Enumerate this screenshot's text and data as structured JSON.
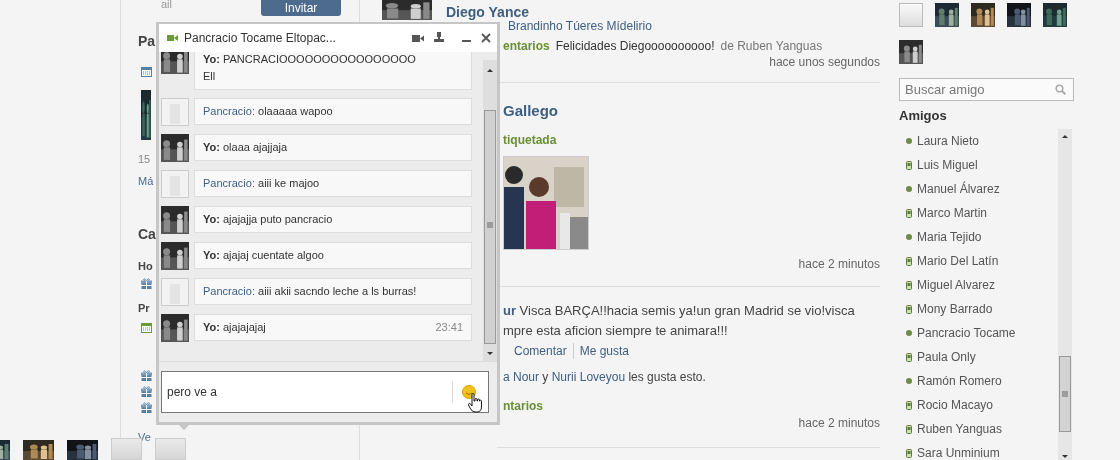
{
  "left_column": {
    "field_fragment": "ail",
    "invite_button": "Invitar",
    "heading": "Pa",
    "count": "15",
    "link": "Má",
    "section_heading": "Ca",
    "label_today": "Ho",
    "label_next": "Pr",
    "link_more": "Ve"
  },
  "feed": {
    "posts": [
      {
        "avatar": {
          "kind": "picture"
        },
        "author": "Diego Yance",
        "tagged": "Brandinho Túeres Mídelirio",
        "comments_label": "entarios",
        "comment": {
          "text": "Felicidades Diegoooooooooo!",
          "by": "de Ruben Yanguas"
        },
        "time": "hace unos segundos"
      },
      {
        "author": "Gallego",
        "activity": "tiquetada",
        "photo": {
          "kind": "picture"
        },
        "time": "hace 2 minutos"
      },
      {
        "author": "ur",
        "status_lines": [
          "Visca BARÇA!!hacia semis ya!un gran Madrid se vio!visca",
          "mpre esta aficion siempre te animara!!!"
        ],
        "actions": [
          "Comentar",
          "Me gusta"
        ],
        "likes": {
          "names": [
            "a Nour",
            "Nurii Loveyou"
          ],
          "joiner": "y",
          "suffix": "les gusta esto."
        },
        "comments_label": "ntarios",
        "time": "hace 2 minutos"
      }
    ]
  },
  "right_column": {
    "photos": [
      {
        "kind": "blank"
      },
      {
        "kind": "picture"
      },
      {
        "kind": "picture"
      },
      {
        "kind": "picture"
      },
      {
        "kind": "picture"
      },
      {
        "kind": "picture"
      }
    ],
    "search": {
      "placeholder": "Buscar amigo"
    },
    "friends_heading": "Amigos",
    "friends": [
      {
        "name": "Laura Nieto",
        "kind": "online"
      },
      {
        "name": "Luis Miguel",
        "kind": "mobile"
      },
      {
        "name": "Manuel Álvarez",
        "kind": "online"
      },
      {
        "name": "Marco Martin",
        "kind": "mobile"
      },
      {
        "name": "Maria Tejido",
        "kind": "online"
      },
      {
        "name": "Mario Del Latín",
        "kind": "mobile"
      },
      {
        "name": "Miguel Alvarez",
        "kind": "mobile"
      },
      {
        "name": "Mony Barrado",
        "kind": "mobile"
      },
      {
        "name": "Pancracio Tocame",
        "kind": "online"
      },
      {
        "name": "Paula Only",
        "kind": "mobile"
      },
      {
        "name": "Ramón Romero",
        "kind": "online"
      },
      {
        "name": "Rocio Macayo",
        "kind": "mobile"
      },
      {
        "name": "Ruben Yanguas",
        "kind": "mobile"
      },
      {
        "name": "Sara Unminium",
        "kind": "mobile"
      }
    ]
  },
  "chat": {
    "title": "Pancracio Tocame Eltopac...",
    "messages": [
      {
        "kind": "self",
        "sender": "Yo:",
        "lines": [
          "PANCRACIOOOOOOOOOOOOOOOO",
          "Ell"
        ]
      },
      {
        "kind": "friend",
        "sender": "Pancracio:",
        "lines": [
          "olaaaaa wapoo"
        ]
      },
      {
        "kind": "self",
        "sender": "Yo:",
        "lines": [
          "olaaa ajajjaja"
        ]
      },
      {
        "kind": "friend",
        "sender": "Pancracio:",
        "lines": [
          "aiii ke majoo"
        ]
      },
      {
        "kind": "self",
        "sender": "Yo:",
        "lines": [
          "ajajajja puto pancracio"
        ]
      },
      {
        "kind": "self",
        "sender": "Yo:",
        "lines": [
          "ajajaj cuentate algoo"
        ]
      },
      {
        "kind": "friend",
        "sender": "Pancracio:",
        "lines": [
          "aiii akii sacndo leche a ls burras!"
        ]
      },
      {
        "kind": "self",
        "sender": "Yo:",
        "lines": [
          "ajajajajaj"
        ],
        "time": "23:41"
      }
    ],
    "input": {
      "value": "pero ve a"
    }
  },
  "chat_bar": {
    "thumbnails": [
      {
        "kind": "picture"
      },
      {
        "kind": "picture"
      },
      {
        "kind": "picture"
      },
      {
        "kind": "blank"
      },
      {
        "kind": "blank"
      }
    ]
  }
}
